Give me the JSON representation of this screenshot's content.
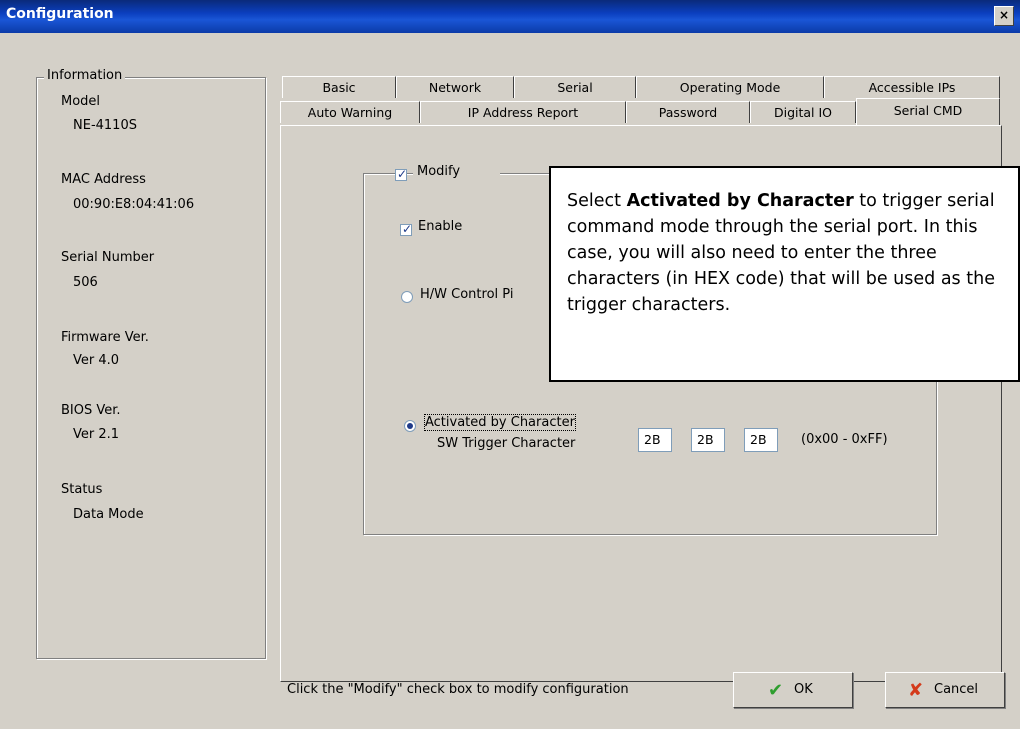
{
  "window": {
    "title": "Configuration",
    "close_glyph": "×"
  },
  "info": {
    "legend": "Information",
    "model_label": "Model",
    "model_value": "NE-4110S",
    "mac_label": "MAC Address",
    "mac_value": "00:90:E8:04:41:06",
    "serial_label": "Serial Number",
    "serial_value": "506",
    "fw_label": "Firmware Ver.",
    "fw_value": "Ver 4.0",
    "bios_label": "BIOS Ver.",
    "bios_value": "Ver 2.1",
    "status_label": "Status",
    "status_value": "Data Mode"
  },
  "tabs": {
    "back": [
      "Basic",
      "Network",
      "Serial",
      "Operating Mode",
      "Accessible IPs"
    ],
    "front": [
      "Auto Warning",
      "IP Address Report",
      "Password",
      "Digital IO",
      "Serial CMD"
    ],
    "active": "Serial CMD"
  },
  "form": {
    "modify_label": "Modify",
    "enable_label": "Enable",
    "hw_label": "H/W Control Pi",
    "activated_label": "Activated by Character",
    "sw_trigger_label": "SW Trigger Character",
    "char1": "2B",
    "char2": "2B",
    "char3": "2B",
    "range_hint": "(0x00 - 0xFF)"
  },
  "callout": {
    "before": "Select ",
    "bold": "Activated by Character",
    "after": " to trigger serial command mode through the serial port. In this case, you will also need to enter the three characters (in HEX code) that will be used as the trigger characters."
  },
  "footer": {
    "hint": "Click the \"Modify\" check box to modify configuration",
    "ok_label": "OK",
    "ok_icon": "✔",
    "cancel_label": "Cancel",
    "cancel_icon": "✘"
  },
  "colors": {
    "title_bar": "#0b3fbf",
    "ok_icon": "#2e9e2e",
    "cancel_icon": "#d43a1a"
  }
}
